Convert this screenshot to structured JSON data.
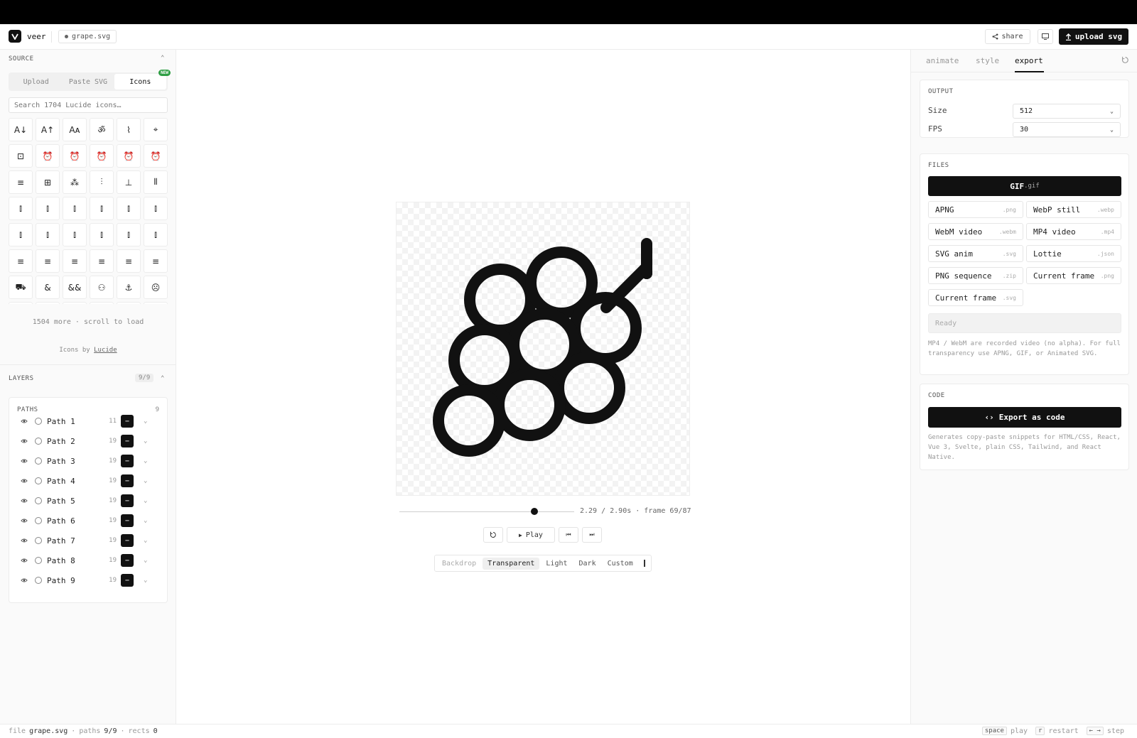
{
  "app": {
    "name": "veer",
    "file_name": "grape.svg"
  },
  "header": {
    "share_label": "share",
    "upload_label": "upload svg"
  },
  "source": {
    "title": "SOURCE",
    "tabs": [
      "Upload",
      "Paste SVG",
      "Icons"
    ],
    "new_badge": "NEW",
    "search_placeholder": "Search 1704 Lucide icons…",
    "icons": [
      "A↓",
      "A↑",
      "Aᴀ",
      "ॐ",
      "⌇",
      "⌖",
      "⊡",
      "⏰",
      "⏰",
      "⏰",
      "⏰",
      "⏰",
      "≡",
      "⊞",
      "⁂",
      "⫶",
      "⊥",
      "⫴",
      "⫾",
      "⫾",
      "⫾",
      "⫾",
      "⫾",
      "⫾",
      "⫾",
      "⫾",
      "⫾",
      "⫾",
      "⫾",
      "⫾",
      "≡",
      "≡",
      "≡",
      "≡",
      "≡",
      "≡",
      "⛟",
      "&",
      "&&",
      "⚇",
      "⚓",
      "☹",
      "·",
      "·",
      "·",
      "·",
      "·",
      "·"
    ],
    "more_text": "1504 more · scroll to load",
    "credit_prefix": "Icons by ",
    "credit_link": "Lucide"
  },
  "layers": {
    "title": "LAYERS",
    "count": "9/9",
    "paths_title": "PATHS",
    "paths_count": "9",
    "paths": [
      {
        "label": "Path 1",
        "value": "11"
      },
      {
        "label": "Path 2",
        "value": "19"
      },
      {
        "label": "Path 3",
        "value": "19"
      },
      {
        "label": "Path 4",
        "value": "19"
      },
      {
        "label": "Path 5",
        "value": "19"
      },
      {
        "label": "Path 6",
        "value": "19"
      },
      {
        "label": "Path 7",
        "value": "19"
      },
      {
        "label": "Path 8",
        "value": "19"
      },
      {
        "label": "Path 9",
        "value": "19"
      }
    ]
  },
  "player": {
    "time_text": "2.29 / 2.90s · frame 69/87",
    "progress": 0.79,
    "play_label": "Play",
    "backdrop": [
      "Backdrop",
      "Transparent",
      "Light",
      "Dark",
      "Custom"
    ]
  },
  "panel": {
    "tabs": [
      "animate",
      "style",
      "export"
    ],
    "output": {
      "title": "OUTPUT",
      "size_label": "Size",
      "size_value": "512",
      "fps_label": "FPS",
      "fps_value": "30"
    },
    "files": {
      "title": "FILES",
      "gif_name": "GIF",
      "gif_ext": ".gif",
      "formats": [
        {
          "name": "APNG",
          "ext": ".png"
        },
        {
          "name": "WebP still",
          "ext": ".webp"
        },
        {
          "name": "WebM video",
          "ext": ".webm"
        },
        {
          "name": "MP4 video",
          "ext": ".mp4"
        },
        {
          "name": "SVG anim",
          "ext": ".svg"
        },
        {
          "name": "Lottie",
          "ext": ".json"
        },
        {
          "name": "PNG sequence",
          "ext": ".zip"
        },
        {
          "name": "Current frame",
          "ext": ".png"
        },
        {
          "name": "Current frame",
          "ext": ".svg"
        }
      ],
      "status": "Ready",
      "note": "MP4 / WebM are recorded video (no alpha). For full transparency use APNG, GIF, or Animated SVG."
    },
    "code": {
      "title": "CODE",
      "button": "Export as code",
      "note": "Generates copy-paste snippets for HTML/CSS, React, Vue 3, Svelte, plain CSS, Tailwind, and React Native."
    }
  },
  "footer": {
    "file_label": "file",
    "file_value": "grape.svg",
    "paths_label": "paths",
    "paths_value": "9/9",
    "rects_label": "rects",
    "rects_value": "0",
    "keys": [
      {
        "key": "space",
        "action": "play"
      },
      {
        "key": "r",
        "action": "restart"
      },
      {
        "key": "← →",
        "action": "step"
      }
    ]
  }
}
